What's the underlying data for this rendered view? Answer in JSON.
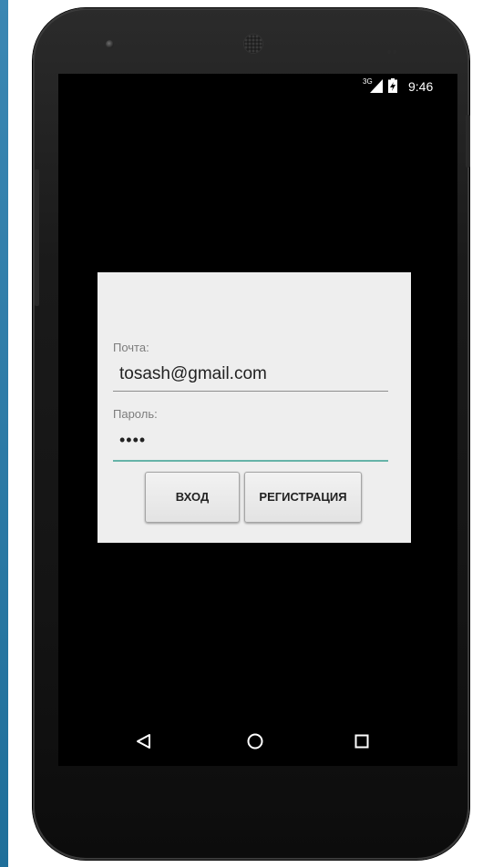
{
  "status_bar": {
    "network_label": "3G",
    "time": "9:46",
    "icons": [
      "signal-icon",
      "battery-icon"
    ]
  },
  "login_dialog": {
    "email_label": "Почта:",
    "email_value": "tosash@gmail.com",
    "password_label": "Пароль:",
    "password_value": "••••",
    "login_button_label": "ВХОД",
    "register_button_label": "РЕГИСТРАЦИЯ"
  },
  "nav_bar": {
    "icons": [
      "back-icon",
      "home-icon",
      "recents-icon"
    ]
  },
  "colors": {
    "dialog_background": "#eeeeee",
    "password_underline_accent": "#66b3a8",
    "screen_background": "#000000"
  }
}
